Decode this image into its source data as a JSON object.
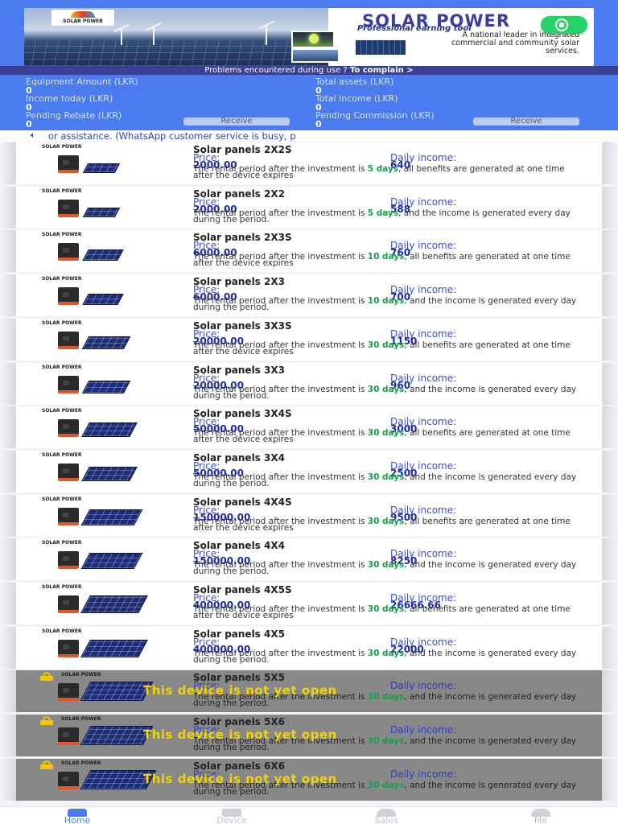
{
  "banner": {
    "logo_text": "SOLAR POWER",
    "title": "SOLAR POWER",
    "subtitle": "Professional earning tool",
    "description": "A national leader in integrated commercial and community solar services."
  },
  "complain": {
    "text": "Problems encountered during use ? ",
    "link": "To complain >"
  },
  "stats": {
    "equipment_amount": {
      "label": "Equipment Amount (LKR)",
      "value": "0"
    },
    "total_assets": {
      "label": "Total assets (LKR)",
      "value": "0"
    },
    "income_today": {
      "label": "Income today (LKR)",
      "value": "0"
    },
    "total_income": {
      "label": "Total income (LKR)",
      "value": "0"
    },
    "pending_rebate": {
      "label": "Pending Rebate (LKR)",
      "value": "0",
      "button": "Receive"
    },
    "pending_commission": {
      "label": "Pending Commission (LKR)",
      "value": "0",
      "button": "Receive"
    }
  },
  "notice": {
    "icon": "speaker-icon",
    "text": "or assistance. (WhatsApp customer service is busy, p"
  },
  "labels": {
    "price": "Price:",
    "daily_income": "Daily income:",
    "brand": "SOLAR POWER",
    "locked": "This device is not yet open"
  },
  "products": [
    {
      "name": "Solar panels 2X2S",
      "price": "2000.00",
      "daily": "640",
      "pre": "The rental period after the investment is ",
      "days": "5 days",
      "post": ", all benefits are generated at one time after the device expires",
      "locked": false
    },
    {
      "name": "Solar panels 2X2",
      "price": "2000.00",
      "daily": "588",
      "pre": "The rental period after the investment is ",
      "days": "5 days",
      "post": ", and the income is generated every day during the period.",
      "locked": false
    },
    {
      "name": "Solar panels 2X3S",
      "price": "6000.00",
      "daily": "760",
      "pre": "The rental period after the investment is ",
      "days": "10 days",
      "post": ", all benefits are generated at one time after the device expires",
      "locked": false
    },
    {
      "name": "Solar panels 2X3",
      "price": "6000.00",
      "daily": "700",
      "pre": "The rental period after the investment is ",
      "days": "10 days",
      "post": ", and the income is generated every day during the period.",
      "locked": false
    },
    {
      "name": "Solar panels 3X3S",
      "price": "20000.00",
      "daily": "1150",
      "pre": "The rental period after the investment is ",
      "days": "30 days",
      "post": ", all benefits are generated at one time after the device expires",
      "locked": false
    },
    {
      "name": "Solar panels 3X3",
      "price": "20000.00",
      "daily": "960",
      "pre": "The rental period after the investment is ",
      "days": "30 days",
      "post": ", and the income is generated every day during the period.",
      "locked": false
    },
    {
      "name": "Solar panels 3X4S",
      "price": "50000.00",
      "daily": "3000",
      "pre": "The rental period after the investment is ",
      "days": "30 days",
      "post": ", all benefits are generated at one time after the device expires",
      "locked": false
    },
    {
      "name": "Solar panels 3X4",
      "price": "50000.00",
      "daily": "2500",
      "pre": "The rental period after the investment is ",
      "days": "30 days",
      "post": ", and the income is generated every day during the period.",
      "locked": false
    },
    {
      "name": "Solar panels 4X4S",
      "price": "150000.00",
      "daily": "9500",
      "pre": "The rental period after the investment is ",
      "days": "30 days",
      "post": ", all benefits are generated at one time after the device expires",
      "locked": false
    },
    {
      "name": "Solar panels 4X4",
      "price": "150000.00",
      "daily": "8250",
      "pre": "The rental period after the investment is ",
      "days": "30 days",
      "post": ", and the income is generated every day during the period.",
      "locked": false
    },
    {
      "name": "Solar panels 4X5S",
      "price": "400000.00",
      "daily": "26666.66",
      "pre": "The rental period after the investment is ",
      "days": "30 days",
      "post": ", all benefits are generated at one time after the device expires",
      "locked": false
    },
    {
      "name": "Solar panels 4X5",
      "price": "400000.00",
      "daily": "22000",
      "pre": "The rental period after the investment is ",
      "days": "30 days",
      "post": ", and the income is generated every day during the period.",
      "locked": false
    },
    {
      "name": "Solar panels 5X5",
      "price": "",
      "daily": "",
      "pre": "The rental period after the investment is ",
      "days": "30 days",
      "post": ", and the income is generated every day during the period.",
      "locked": true
    },
    {
      "name": "Solar panels 5X6",
      "price": "",
      "daily": "",
      "pre": "The rental period after the investment is ",
      "days": "30 days",
      "post": ", and the income is generated every day during the period.",
      "locked": true
    },
    {
      "name": "Solar panels 6X6",
      "price": "",
      "daily": "",
      "pre": "The rental period after the investment is ",
      "days": "30 days",
      "post": ", and the income is generated every day during the period.",
      "locked": true
    }
  ],
  "tabs": [
    {
      "label": "Home",
      "icon": "home-icon",
      "active": true
    },
    {
      "label": "Device",
      "icon": "device-icon",
      "active": false
    },
    {
      "label": "Sales",
      "icon": "sales-icon",
      "active": false
    },
    {
      "label": "Me",
      "icon": "me-icon",
      "active": false
    }
  ],
  "colors": {
    "header_blue": "#4a7cf0",
    "complain_bar": "#3a3f93",
    "price_blue": "#1c2aa8",
    "days_green": "#14a04a",
    "locked_gray": "#888888",
    "locked_text": "#f3d400",
    "whatsapp_green": "#25d366"
  }
}
